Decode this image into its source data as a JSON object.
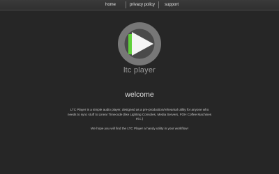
{
  "nav": {
    "items": [
      {
        "label": "home"
      },
      {
        "label": "privacy policy"
      },
      {
        "label": "support"
      }
    ]
  },
  "hero": {
    "logo_icon": "play-icon",
    "title": "ltc player"
  },
  "content": {
    "heading": "welcome",
    "intro": "LTC Player is a simple audio player, designed as a pre-production/rehearsal utility for anyone who needs to sync stuff to Linear Timecode (like Lighting Consoles, Media Servers, FOH Coffee Machines et.c.)",
    "hope": "We hope you will find the LTC Player a handy utility in your workflow!"
  },
  "colors": {
    "background": "#262626",
    "nav_background": "#333333",
    "logo_ring": "#7a7a7a",
    "logo_accent": "#5fcf3a"
  }
}
